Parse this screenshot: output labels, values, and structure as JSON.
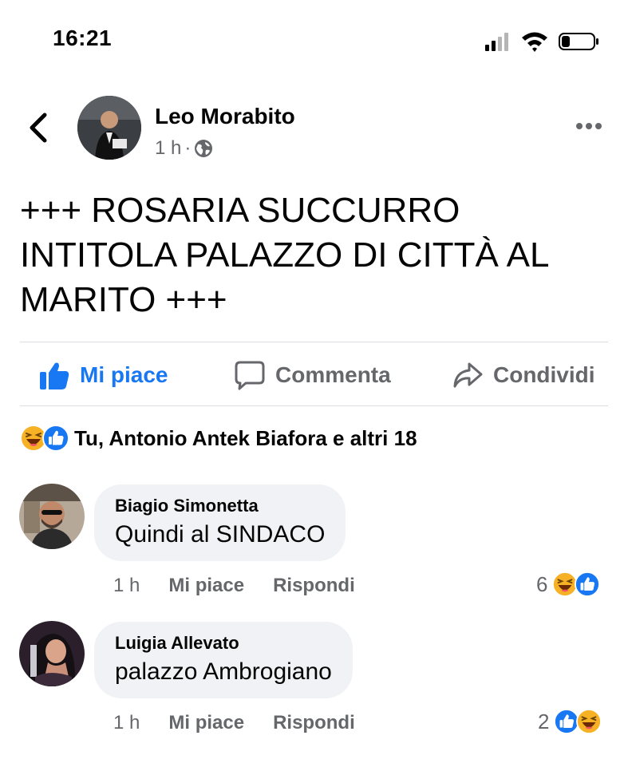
{
  "status_bar": {
    "time": "16:21"
  },
  "post": {
    "author": "Leo Morabito",
    "time": "1 h",
    "separator": "·",
    "text": "+++ ROSARIA SUCCURRO INTITOLA PALAZZO DI CITTÀ AL MARITO +++"
  },
  "actions": {
    "like": "Mi piace",
    "comment": "Commenta",
    "share": "Condividi"
  },
  "reactions": {
    "summary": "Tu, Antonio Antek Biafora e altri 18",
    "icons": [
      "haha-icon",
      "like-icon"
    ]
  },
  "comments": [
    {
      "name": "Biagio Simonetta",
      "text": "Quindi al SINDACO",
      "time": "1 h",
      "like": "Mi piace",
      "reply": "Rispondi",
      "count": "6",
      "icons": [
        "haha-icon",
        "like-icon"
      ]
    },
    {
      "name": "Luigia Allevato",
      "text": "palazzo Ambrogiano",
      "time": "1 h",
      "like": "Mi piace",
      "reply": "Rispondi",
      "count": "2",
      "icons": [
        "like-icon",
        "haha-icon"
      ]
    }
  ],
  "colors": {
    "accent": "#1877f2",
    "secondary_text": "#65676b",
    "bubble": "#f0f2f5",
    "haha": "#f7b125"
  }
}
